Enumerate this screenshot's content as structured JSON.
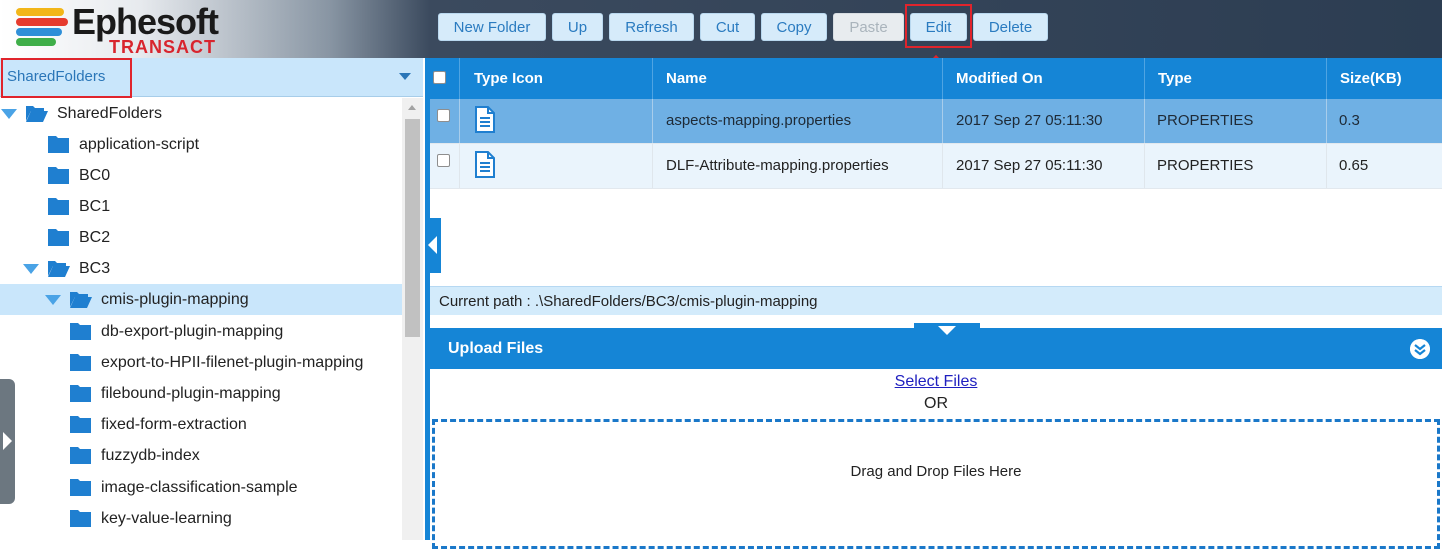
{
  "app": {
    "logo_text": "Ephesoft",
    "logo_sub": "TRANSACT"
  },
  "toolbar": {
    "new_folder": "New Folder",
    "up": "Up",
    "refresh": "Refresh",
    "cut": "Cut",
    "copy": "Copy",
    "paste": "Paste",
    "edit": "Edit",
    "delete": "Delete"
  },
  "folder_select": {
    "value": "SharedFolders"
  },
  "tree": {
    "items": [
      {
        "label": "SharedFolders",
        "state": "open"
      },
      {
        "label": "application-script",
        "state": "closed"
      },
      {
        "label": "BC0",
        "state": "closed"
      },
      {
        "label": "BC1",
        "state": "closed"
      },
      {
        "label": "BC2",
        "state": "closed"
      },
      {
        "label": "BC3",
        "state": "open"
      },
      {
        "label": "cmis-plugin-mapping",
        "state": "open",
        "selected": true
      },
      {
        "label": "db-export-plugin-mapping",
        "state": "closed"
      },
      {
        "label": "export-to-HPII-filenet-plugin-mapping",
        "state": "closed"
      },
      {
        "label": "filebound-plugin-mapping",
        "state": "closed"
      },
      {
        "label": "fixed-form-extraction",
        "state": "closed"
      },
      {
        "label": "fuzzydb-index",
        "state": "closed"
      },
      {
        "label": "image-classification-sample",
        "state": "closed"
      },
      {
        "label": "key-value-learning",
        "state": "closed"
      }
    ]
  },
  "grid": {
    "columns": {
      "type_icon": "Type Icon",
      "name": "Name",
      "modified_on": "Modified On",
      "type": "Type",
      "size": "Size(KB)"
    },
    "rows": [
      {
        "icon": "document-icon",
        "name": "aspects-mapping.properties",
        "modified_on": "2017 Sep 27 05:11:30",
        "type": "PROPERTIES",
        "size": "0.3"
      },
      {
        "icon": "document-icon",
        "name": "DLF-Attribute-mapping.properties",
        "modified_on": "2017 Sep 27 05:11:30",
        "type": "PROPERTIES",
        "size": "0.65"
      }
    ]
  },
  "path": {
    "text": "Current path : .\\SharedFolders/BC3/cmis-plugin-mapping"
  },
  "upload": {
    "title": "Upload Files",
    "select_files": "Select Files",
    "or": "OR",
    "drop_text": "Drag and Drop Files Here"
  },
  "colors": {
    "accent": "#1585d6",
    "highlight": "#e0242c",
    "selected_row": "#6fb0e4"
  }
}
